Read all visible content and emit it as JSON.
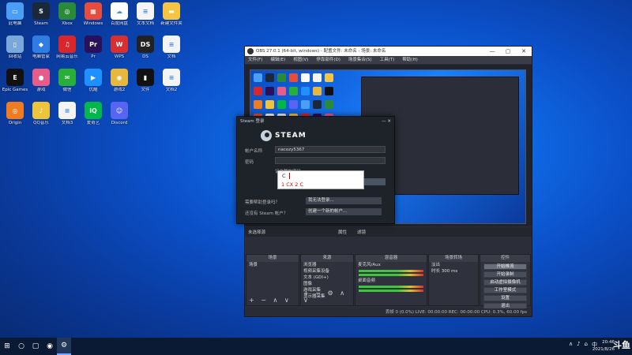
{
  "desktop": {
    "icons": [
      {
        "label": "此电脑",
        "color": "#4a9ff5",
        "glyph": "▭"
      },
      {
        "label": "Steam",
        "color": "#1b2838",
        "glyph": "S"
      },
      {
        "label": "Xbox",
        "color": "#2a8a3a",
        "glyph": "◎"
      },
      {
        "label": "Windows",
        "color": "#e74c3c",
        "glyph": "▦"
      },
      {
        "label": "百度网盘",
        "color": "#ffffff",
        "glyph": "☁"
      },
      {
        "label": "文本文档",
        "color": "#f4f4f4",
        "glyph": "≡"
      },
      {
        "label": "新建文件夹",
        "color": "#f5c542",
        "glyph": "▬"
      },
      {
        "label": "回收站",
        "color": "#7aa8d8",
        "glyph": "▯"
      },
      {
        "label": "电脑管家",
        "color": "#2f7de1",
        "glyph": "◆"
      },
      {
        "label": "网易云音乐",
        "color": "#d8262a",
        "glyph": "♫"
      },
      {
        "label": "Pr",
        "color": "#2a0f5a",
        "glyph": "Pr"
      },
      {
        "label": "WPS",
        "color": "#d92f2f",
        "glyph": "W"
      },
      {
        "label": "DS",
        "color": "#222222",
        "glyph": "DS"
      },
      {
        "label": "文档",
        "color": "#f4f4f4",
        "glyph": "≡"
      },
      {
        "label": "Epic Games",
        "color": "#111111",
        "glyph": "E"
      },
      {
        "label": "游戏",
        "color": "#e85c8a",
        "glyph": "●"
      },
      {
        "label": "微信",
        "color": "#2aae3a",
        "glyph": "✉"
      },
      {
        "label": "优酷",
        "color": "#1e90ff",
        "glyph": "▶"
      },
      {
        "label": "游戏2",
        "color": "#e8b83c",
        "glyph": "◉"
      },
      {
        "label": "文件",
        "color": "#111111",
        "glyph": "▮"
      },
      {
        "label": "文档2",
        "color": "#f4f4f4",
        "glyph": "≡"
      },
      {
        "label": "Origin",
        "color": "#f07c22",
        "glyph": "◎"
      },
      {
        "label": "QQ音乐",
        "color": "#eec43a",
        "glyph": "♪"
      },
      {
        "label": "文档3",
        "color": "#f4f4f4",
        "glyph": "≡"
      },
      {
        "label": "爱奇艺",
        "color": "#00b74a",
        "glyph": "iQ"
      },
      {
        "label": "Discord",
        "color": "#5865f2",
        "glyph": "☺"
      }
    ]
  },
  "obs": {
    "title": "OBS 27.0.1 (64-bit, windows) - 配置文件: 未命名 - 场景: 未命名",
    "menus": [
      "文件(F)",
      "编辑(E)",
      "视图(V)",
      "停靠部件(D)",
      "场景集合(S)",
      "工具(T)",
      "帮助(H)"
    ],
    "midbar": {
      "source": "未选择源",
      "props": "属性",
      "filters": "滤镜"
    },
    "docks": {
      "scenes": {
        "header": "场景",
        "items": [
          "场景"
        ]
      },
      "sources": {
        "header": "来源",
        "items": [
          "浏览器",
          "视频采集设备",
          "文本 (GDI+)",
          "图像",
          "游戏采集",
          "显示器采集"
        ]
      },
      "mixer": {
        "header": "混音器",
        "items": [
          "麦克风/Aux",
          "桌面音频"
        ]
      },
      "transitions": {
        "header": "场景转场",
        "items": [
          "淡出",
          "时长 300 ms"
        ]
      },
      "controls": {
        "header": "控件",
        "buttons": [
          "开始推流",
          "开始录制",
          "启动虚拟摄像机",
          "工作室模式",
          "设置",
          "退出"
        ]
      }
    },
    "status": "丢帧 0 (0.0%)   LIVE: 00:00:00   REC: 00:00:00   CPU: 0.3%, 60.00 fps"
  },
  "steam": {
    "title": "Steam 登录",
    "brand": "STEAM",
    "account_label": "帐户名称",
    "account_value": "nacozy5367",
    "password_label": "密码",
    "remember": "记住我的密码",
    "login_button": "登录",
    "help_label": "需要帮助登录吗？",
    "help_button": "我无法登录...",
    "new_label": "还没有 Steam 帐户？",
    "new_button": "创建一个新的帐户..."
  },
  "ime": {
    "composition": "C",
    "candidates": "1 CX  2 C"
  },
  "taskbar": {
    "items": [
      "⊞",
      "○",
      "▢",
      "◉",
      "⚙"
    ],
    "tray_icons": [
      "∧",
      "♪",
      "⌂",
      "中"
    ],
    "time": "20:46",
    "date": "2021/8/26",
    "watermark": "斗鱼"
  }
}
